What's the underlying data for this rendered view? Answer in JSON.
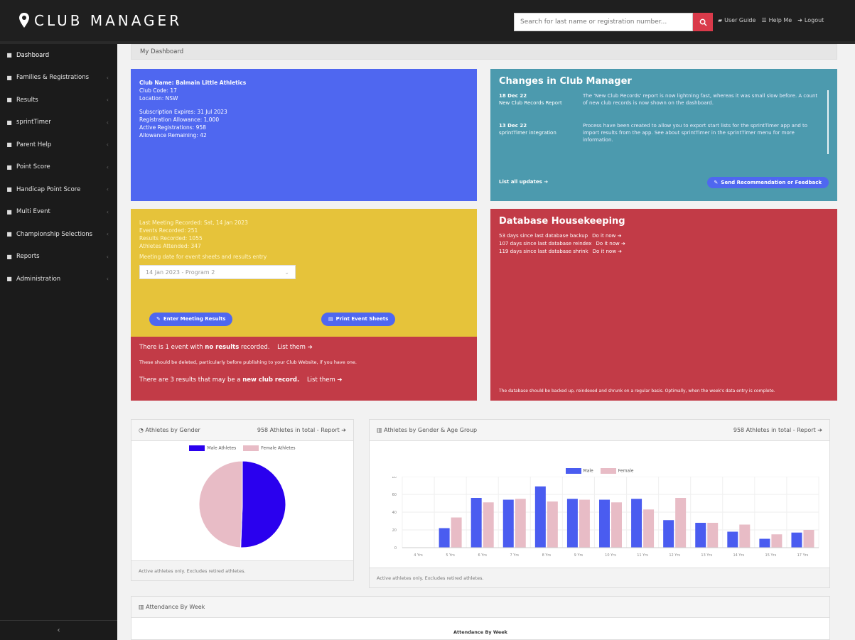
{
  "app": {
    "title": "CLUB MANAGER"
  },
  "search": {
    "placeholder": "Search for last name or registration number..."
  },
  "top_links": {
    "user_guide": "User Guide",
    "help_me": "Help Me",
    "logout": "Logout"
  },
  "sidebar": {
    "items": [
      {
        "label": "Dashboard",
        "icon": "tachometer-icon",
        "has_chevron": false
      },
      {
        "label": "Families & Registrations",
        "icon": "users-icon",
        "has_chevron": true
      },
      {
        "label": "Results",
        "icon": "clipboard-icon",
        "has_chevron": true
      },
      {
        "label": "sprintTimer",
        "icon": "clock-icon",
        "has_chevron": true
      },
      {
        "label": "Parent Help",
        "icon": "book-icon",
        "has_chevron": true
      },
      {
        "label": "Point Score",
        "icon": "trophy-icon",
        "has_chevron": true
      },
      {
        "label": "Handicap Point Score",
        "icon": "medal-icon",
        "has_chevron": true
      },
      {
        "label": "Multi Event",
        "icon": "cog-icon",
        "has_chevron": true
      },
      {
        "label": "Championship Selections",
        "icon": "check-icon",
        "has_chevron": true
      },
      {
        "label": "Reports",
        "icon": "file-icon",
        "has_chevron": true
      },
      {
        "label": "Administration",
        "icon": "gear-icon",
        "has_chevron": true
      }
    ],
    "collapse_label": "‹"
  },
  "page": {
    "breadcrumb": "My Dashboard"
  },
  "club_card": {
    "club_name": "Club Name: Balmain Little Athletics",
    "club_code": "Club Code: 17",
    "location": "Location: NSW",
    "subscription": "Subscription Expires: 31 Jul 2023",
    "allowance": "Registration Allowance: 1,000",
    "active": "Active Registrations: 958",
    "remaining": "Allowance Remaining: 42"
  },
  "changes": {
    "title": "Changes in Club Manager",
    "entries": [
      {
        "date": "18 Dec 22",
        "name": "New Club Records Report",
        "text": "The 'New Club Records' report is now lightning fast, whereas it was small slow before. A count of new club records is now shown on the dashboard."
      },
      {
        "date": "13 Dec 22",
        "name": "sprintTimer integration",
        "text": "Process have been created to allow you to export start lists for the sprintTimer app and to import results from the app. See about sprintTimer in the sprintTimer menu for more information."
      }
    ],
    "list_all": "List all updates ➔",
    "feedback_button": "Send Recommendation or Feedback"
  },
  "meeting": {
    "last_meeting": "Last Meeting Recorded: Sat, 14 Jan 2023",
    "events": "Events Recorded: 251",
    "results": "Results Recorded: 1055",
    "athletes": "Athletes Attended: 347",
    "date_label": "Meeting date for event sheets and results entry",
    "selected_date": "14 Jan 2023 - Program 2",
    "enter_button": "Enter Meeting Results",
    "print_button": "Print Event Sheets"
  },
  "alerts": {
    "no_results_prefix": "There is 1 event with ",
    "no_results_bold": "no results",
    "no_results_suffix": " recorded.",
    "list_them_1": "List them ➔",
    "advice": "These should be deleted, particularly before publishing to your Club Website, if you have one.",
    "records_prefix": "There are 3 results that may be a ",
    "records_bold": "new club record.",
    "list_them_2": "List them ➔"
  },
  "database": {
    "title": "Database Housekeeping",
    "lines": [
      {
        "text": "53 days since last database backup",
        "link": "Do it now ➔"
      },
      {
        "text": "107 days since last database reindex",
        "link": "Do it now ➔"
      },
      {
        "text": "119 days since last database shrink",
        "link": "Do it now ➔"
      }
    ],
    "footer": "The database should be backed up, reindexed and shrunk on a regular basis. Optimally, when the week's data entry is complete."
  },
  "gender_panel": {
    "title": "Athletes by Gender",
    "report": "958 Athletes in total - Report ➔",
    "footer": "Active athletes only. Excludes retired athletes."
  },
  "age_panel": {
    "title": "Athletes by Gender & Age Group",
    "report": "958 Athletes in total - Report ➔",
    "footer": "Active athletes only. Excludes retired athletes."
  },
  "attendance_panel": {
    "title": "Attendance By Week",
    "chart_title": "Attendance By Week"
  },
  "colors": {
    "blue_card": "#4f67f0",
    "teal_card": "#4c9aae",
    "yellow_card": "#e6c33a",
    "red_card": "#c23b47",
    "male": "#4a5cf0",
    "female": "#e8bcc6",
    "male_pie": "#2a00ee"
  },
  "chart_data": [
    {
      "type": "pie",
      "labels": [
        "Male Athletes",
        "Female Athletes"
      ],
      "values": [
        485,
        473
      ]
    },
    {
      "type": "bar",
      "categories": [
        "4 Yrs",
        "5 Yrs",
        "6 Yrs",
        "7 Yrs",
        "8 Yrs",
        "9 Yrs",
        "10 Yrs",
        "11 Yrs",
        "12 Yrs",
        "13 Yrs",
        "14 Yrs",
        "15 Yrs",
        "17 Yrs"
      ],
      "series": [
        {
          "name": "Male",
          "values": [
            0,
            22,
            56,
            54,
            69,
            55,
            54,
            55,
            31,
            28,
            18,
            10,
            17
          ]
        },
        {
          "name": "Female",
          "values": [
            0,
            34,
            51,
            55,
            52,
            54,
            51,
            43,
            56,
            28,
            26,
            15,
            20
          ]
        }
      ],
      "ylim": [
        0,
        80
      ],
      "yticks": [
        0,
        20,
        40,
        60,
        80
      ]
    }
  ]
}
